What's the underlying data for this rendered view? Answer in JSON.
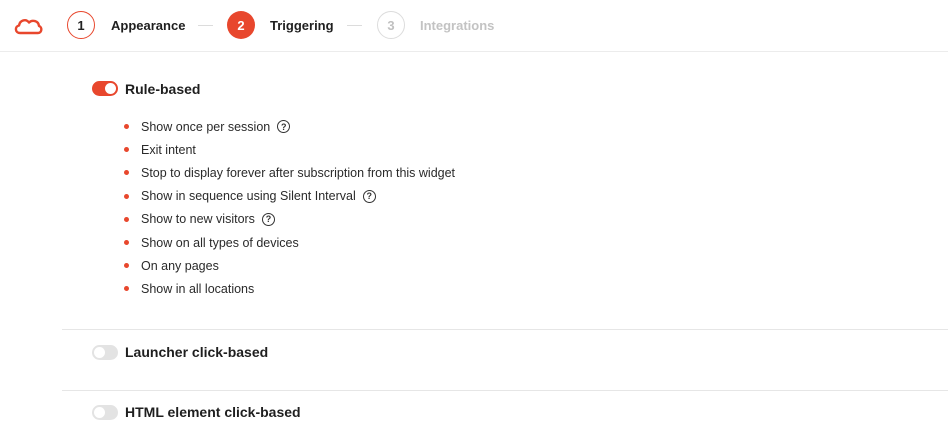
{
  "brand": {
    "logo_icon": "cloud-outline-icon",
    "accent_color": "#e8472d"
  },
  "steps": [
    {
      "number": "1",
      "label": "Appearance",
      "state": "completed"
    },
    {
      "number": "2",
      "label": "Triggering",
      "state": "active"
    },
    {
      "number": "3",
      "label": "Integrations",
      "state": "upcoming"
    }
  ],
  "sections": {
    "rule_based": {
      "title": "Rule-based",
      "enabled": true,
      "rules": [
        {
          "text": "Show once per session",
          "help_icon": true
        },
        {
          "text": "Exit intent",
          "help_icon": false
        },
        {
          "text": "Stop to display forever after subscription from this widget",
          "help_icon": false
        },
        {
          "text": "Show in sequence using Silent Interval",
          "help_icon": true
        },
        {
          "text": "Show to new visitors",
          "help_icon": true
        },
        {
          "text": "Show on all types of devices",
          "help_icon": false
        },
        {
          "text": "On any pages",
          "help_icon": false
        },
        {
          "text": "Show in all locations",
          "help_icon": false
        }
      ]
    },
    "launcher_click": {
      "title": "Launcher click-based",
      "enabled": false
    },
    "html_click": {
      "title": "HTML element click-based",
      "enabled": false
    }
  },
  "help_glyph": "?"
}
